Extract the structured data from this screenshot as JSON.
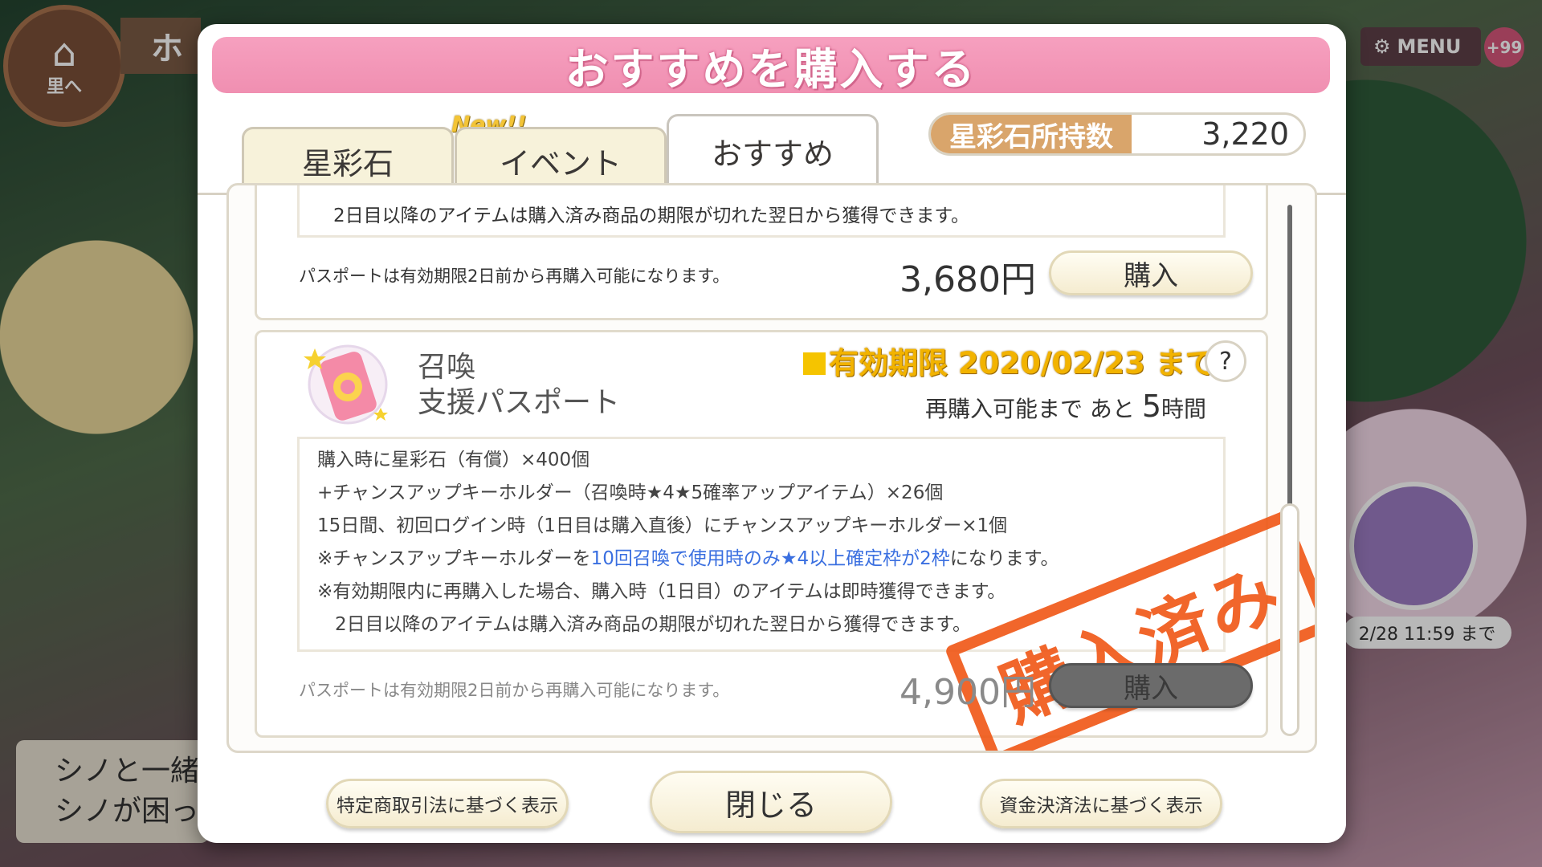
{
  "background": {
    "home_label": "里へ",
    "home_tab": "ホ",
    "menu_label": "MENU",
    "menu_badge": "+99",
    "pickup_time": "2/28 11:59 まで",
    "story_lines": [
      "シノと一緒",
      "シノが困っ"
    ]
  },
  "modal": {
    "title": "おすすめを購入する",
    "tabs": [
      {
        "label": "星彩石",
        "badge": "New!!"
      },
      {
        "label": "イベント"
      },
      {
        "label": "おすすめ",
        "active": true
      }
    ],
    "gem_balance": {
      "label": "星彩石所持数",
      "value": "3,220"
    },
    "card1": {
      "desc_tail": "2日目以降のアイテムは購入済み商品の期限が切れた翌日から獲得できます。",
      "repurchase_note": "パスポートは有効期限2日前から再購入可能になります。",
      "price": "3,680円",
      "buy_label": "購入"
    },
    "card2": {
      "name_line1": "召喚",
      "name_line2": "支援パスポート",
      "expiry": "有効期限 2020/02/23 まで",
      "help_label": "?",
      "rebuy_prefix": "再購入可能まで あと",
      "rebuy_hours": "5",
      "rebuy_suffix": "時間",
      "desc_lines": [
        "購入時に星彩石（有償）×400個",
        "+チャンスアップキーホルダー（召喚時★4★5確率アップアイテム）×26個",
        "15日間、初回ログイン時（1日目は購入直後）にチャンスアップキーホルダー×1個",
        "※有効期限内に再購入した場合、購入時（1日目）のアイテムは即時獲得できます。",
        "2日目以降のアイテムは購入済み商品の期限が切れた翌日から獲得できます。"
      ],
      "desc_line4_prefix": "※チャンスアップキーホルダーを",
      "desc_line4_highlight": "10回召喚で使用時のみ★4以上確定枠が2枠",
      "desc_line4_suffix": "になります。",
      "stamp": "購入済み",
      "repurchase_note": "パスポートは有効期限2日前から再購入可能になります。",
      "price": "4,900円",
      "buy_label": "購入"
    },
    "footer": {
      "left": "特定商取引法に基づく表示",
      "close": "閉じる",
      "right": "資金決済法に基づく表示"
    }
  }
}
